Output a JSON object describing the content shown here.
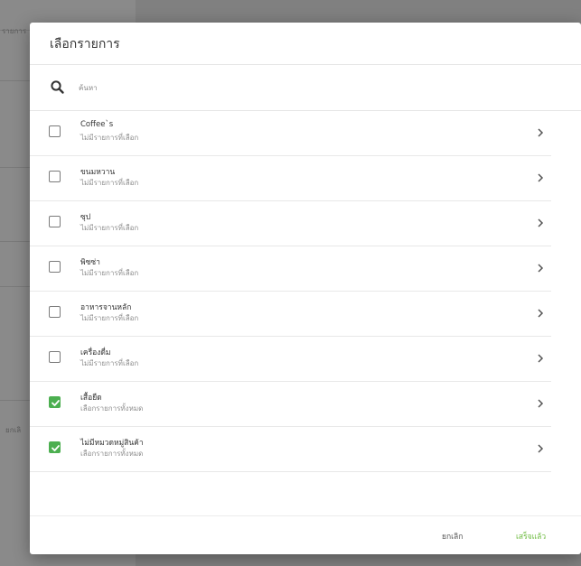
{
  "dialog": {
    "title": "เลือกรายการ",
    "search": {
      "placeholder": "ค้นหา",
      "value": ""
    },
    "items": [
      {
        "title": "Coffee`s",
        "subtitle": "ไม่มีรายการที่เลือก",
        "checked": false
      },
      {
        "title": "ขนมหวาน",
        "subtitle": "ไม่มีรายการที่เลือก",
        "checked": false
      },
      {
        "title": "ซุป",
        "subtitle": "ไม่มีรายการที่เลือก",
        "checked": false
      },
      {
        "title": "พิซซ่า",
        "subtitle": "ไม่มีรายการที่เลือก",
        "checked": false
      },
      {
        "title": "อาหารจานหลัก",
        "subtitle": "ไม่มีรายการที่เลือก",
        "checked": false
      },
      {
        "title": "เครื่องดื่ม",
        "subtitle": "ไม่มีรายการที่เลือก",
        "checked": false
      },
      {
        "title": "เสื้อยืด",
        "subtitle": "เลือกรายการทั้งหมด",
        "checked": true
      },
      {
        "title": "ไม่มีหมวดหมู่สินค้า",
        "subtitle": "เลือกรายการทั้งหมด",
        "checked": true
      }
    ],
    "cancel_label": "ยกเลิก",
    "done_label": "เสร็จแล้ว"
  },
  "background": {
    "truncated_label_top": "รายการ",
    "truncated_label_mid": "ยกเลิ"
  },
  "colors": {
    "accent": "#6dbb3f",
    "checkbox_checked": "#4caf50",
    "scrim": "#808080"
  }
}
